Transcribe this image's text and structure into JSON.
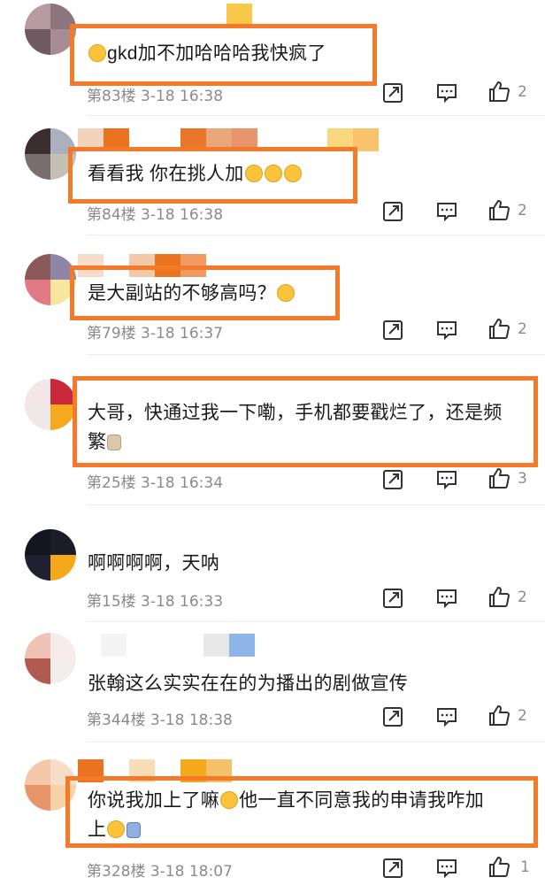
{
  "colors": {
    "highlight": "#f47a2a",
    "meta": "#8a8a8a"
  },
  "comments": [
    {
      "text": "gkd加不加哈哈哈我快疯了",
      "meta": "第83楼  3-18  16:38",
      "likes": "2",
      "emoji_before": "laughing-crying-emoji"
    },
    {
      "text": "看看我  你在挑人加",
      "meta": "第84楼  3-18  16:38",
      "likes": "2",
      "emoji_after": "pleading-face-emoji x3"
    },
    {
      "text": "是大副站的不够高吗？",
      "meta": "第79楼  3-18  16:37",
      "likes": "2",
      "emoji_after": "smirk-emoji"
    },
    {
      "text_line1": "大哥，快通过我一下嘞，手机都要戳烂了，还是频",
      "text_line2": "繁",
      "meta": "第25楼  3-18  16:34",
      "likes": "3",
      "emoji_after": "dog-emoji"
    },
    {
      "text": "啊啊啊啊，天呐",
      "meta": "第15楼  3-18  16:33",
      "likes": "2"
    },
    {
      "text": "张翰这么实实在在的为播出的剧做宣传",
      "meta": "第344楼  3-18  18:38",
      "likes": "2"
    },
    {
      "text_line1a": "你说我加上了嘛",
      "text_line1b": "他一直不同意我的申请我咋加",
      "text_line2": "上",
      "meta": "第328楼  3-18  18:07",
      "likes": "1",
      "emoji_mid": "crying-emoji",
      "emoji_after": "crying-emoji, kneeling-person-emoji"
    }
  ],
  "icons": {
    "share": "share-icon",
    "comment": "comment-icon",
    "like": "thumbs-up-icon"
  }
}
